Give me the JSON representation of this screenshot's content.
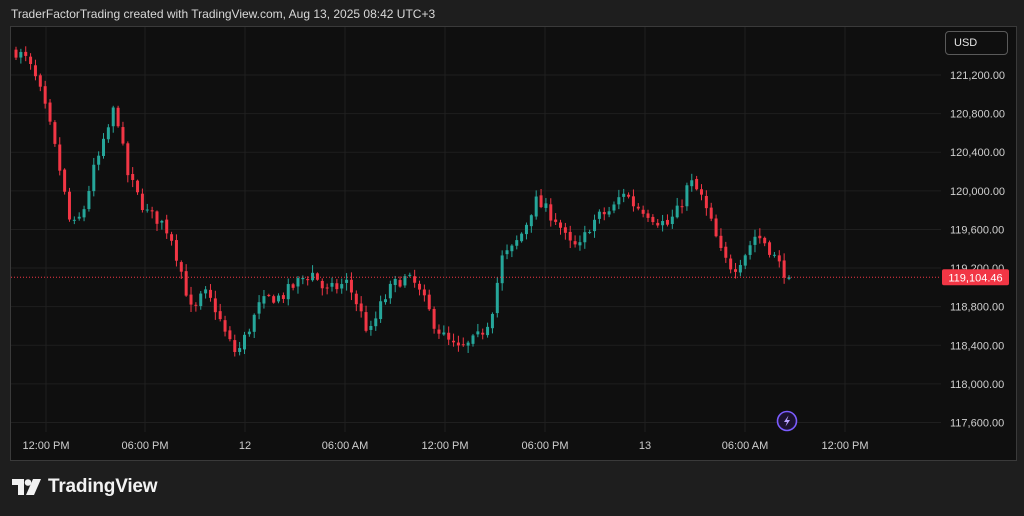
{
  "header": {
    "caption": "TraderFactorTrading created with TradingView.com, Aug 13, 2025 08:42 UTC+3"
  },
  "currency_button": {
    "label": "USD"
  },
  "footer": {
    "brand": "TradingView"
  },
  "icons": {
    "logo": "tradingview-logo-icon",
    "lightning": "lightning-icon"
  },
  "colors": {
    "up": "#26a69a",
    "down": "#f23645",
    "price_label_bg": "#f23645",
    "background": "#0f0f0f"
  },
  "chart_data": {
    "type": "candlestick",
    "ylim": [
      117400,
      121600
    ],
    "y_ticks": [
      121200,
      120800,
      120400,
      120000,
      119600,
      119200,
      118800,
      118400,
      118000,
      117600
    ],
    "y_tick_labels": [
      "121,200.00",
      "120,800.00",
      "120,400.00",
      "120,000.00",
      "119,600.00",
      "119,200.00",
      "118,800.00",
      "118,400.00",
      "118,000.00",
      "117,600.00"
    ],
    "x_tick_labels": [
      "12:00 PM",
      "06:00 PM",
      "12",
      "06:00 AM",
      "12:00 PM",
      "06:00 PM",
      "13",
      "06:00 AM",
      "12:00 PM"
    ],
    "last_price": 119104.46,
    "last_price_label": "119,104.46",
    "grid": true,
    "candle_minutes": 30,
    "path": [
      121450,
      121350,
      121100,
      120700,
      120200,
      119600,
      119750,
      120200,
      120500,
      120900,
      120200,
      119950,
      119750,
      119700,
      119550,
      119150,
      118700,
      118950,
      118800,
      118500,
      118300,
      118550,
      118800,
      118900,
      118900,
      119000,
      119100,
      119150,
      118950,
      119000,
      119050,
      118800,
      118500,
      118800,
      119000,
      119100,
      119050,
      118850,
      118600,
      118450,
      118350,
      118400,
      118500,
      118700,
      119300,
      119400,
      119600,
      119900,
      119800,
      119700,
      119450,
      119400,
      119650,
      119750,
      119800,
      120000,
      119850,
      119800,
      119700,
      119650,
      119800,
      120100,
      119950,
      119650,
      119300,
      119200,
      119350,
      119550,
      119450,
      119250,
      119104.46
    ]
  }
}
